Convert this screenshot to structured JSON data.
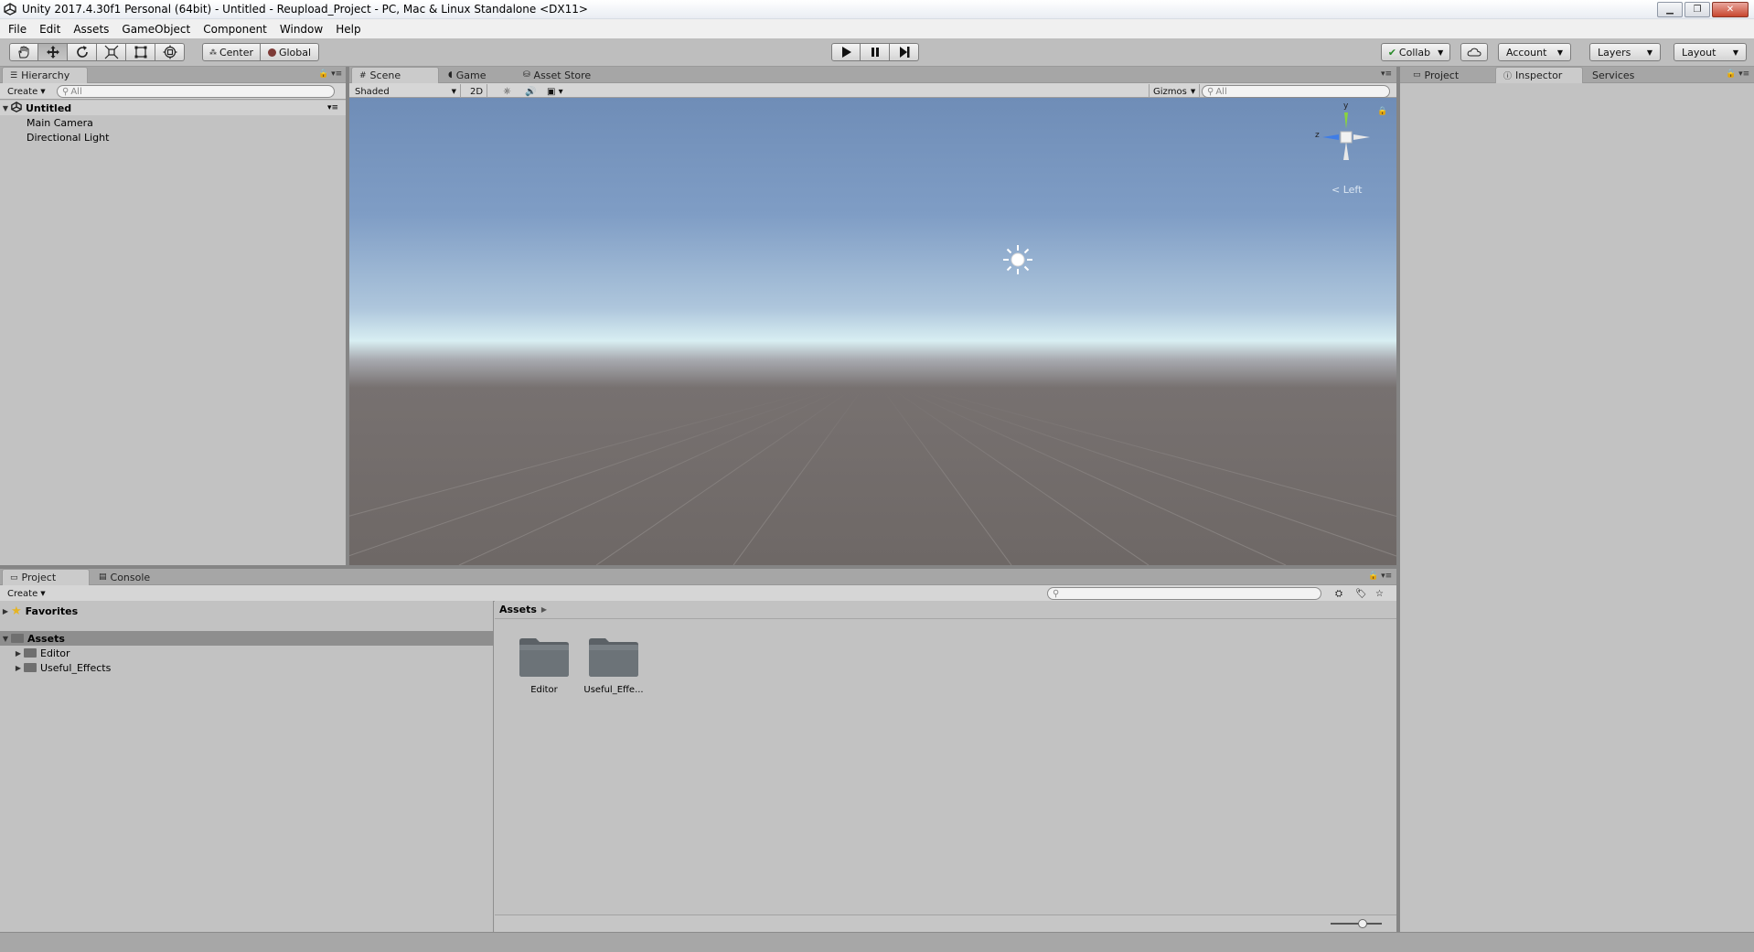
{
  "window": {
    "title": "Unity 2017.4.30f1 Personal (64bit) - Untitled - Reupload_Project - PC, Mac & Linux Standalone <DX11>",
    "controls": [
      "minimize-icon",
      "restore-icon",
      "close-icon"
    ]
  },
  "menu": [
    "File",
    "Edit",
    "Assets",
    "GameObject",
    "Component",
    "Window",
    "Help"
  ],
  "toolbar": {
    "transform_tools": [
      "hand-icon",
      "move-icon",
      "rotate-icon",
      "scale-icon",
      "rect-icon",
      "transform-icon"
    ],
    "pivot": "Center",
    "space": "Global",
    "collab": "Collab",
    "account": "Account",
    "layers": "Layers",
    "layout": "Layout"
  },
  "hierarchy": {
    "tab": "Hierarchy",
    "create": "Create",
    "search_placeholder": "All",
    "scene": "Untitled",
    "items": [
      "Main Camera",
      "Directional Light"
    ]
  },
  "scene_view": {
    "tabs": [
      "Scene",
      "Game",
      "Asset Store"
    ],
    "shading": "Shaded",
    "mode_2d": "2D",
    "gizmos": "Gizmos",
    "search_placeholder": "All",
    "gizmo_axes": [
      "y",
      "z"
    ],
    "view_label": "Left"
  },
  "right_panel": {
    "tabs": [
      "Project",
      "Inspector",
      "Services"
    ]
  },
  "project": {
    "tabs": [
      "Project",
      "Console"
    ],
    "create": "Create",
    "favorites": "Favorites",
    "assets_root": "Assets",
    "folders": [
      "Editor",
      "Useful_Effects"
    ],
    "breadcrumb": "Assets",
    "tiles": [
      "Editor",
      "Useful_Effe..."
    ]
  },
  "colors": {
    "toolbar_bg": "#bebebe",
    "panel_bg": "#c2c2c2",
    "sky_top": "#6f8db7",
    "horizon": "#d8eef2",
    "ground": "#6e6866"
  }
}
